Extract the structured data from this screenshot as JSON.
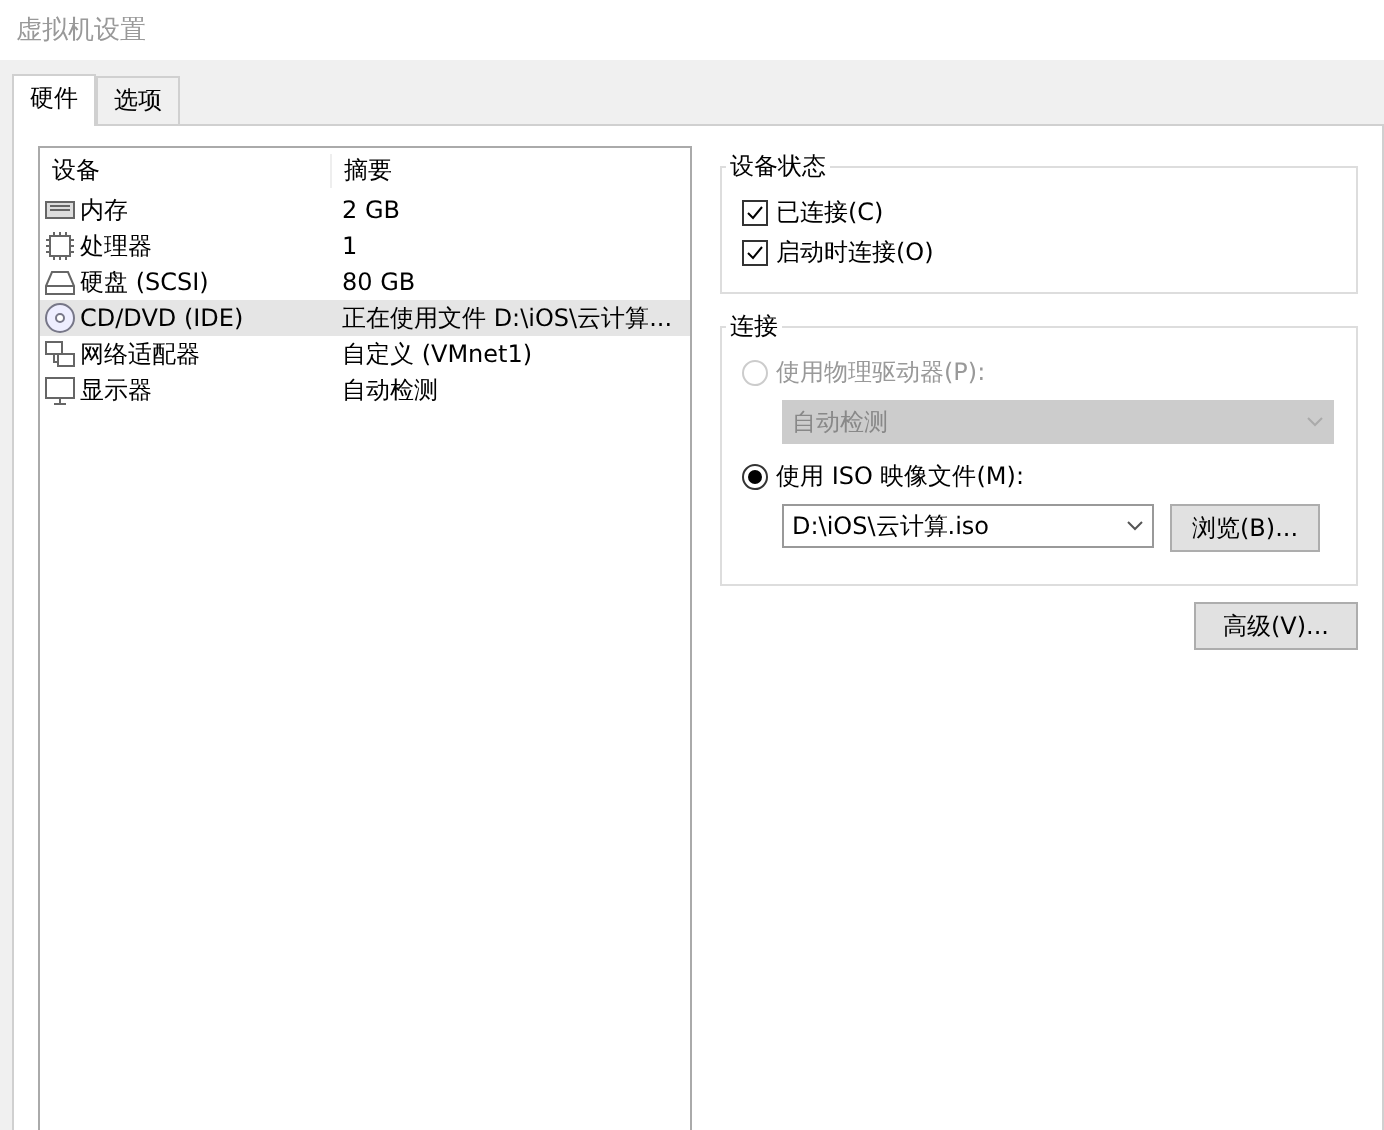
{
  "window": {
    "title": "虚拟机设置"
  },
  "tabs": [
    {
      "label": "硬件",
      "selected": true
    },
    {
      "label": "选项",
      "selected": false
    }
  ],
  "device_table": {
    "columns": [
      "设备",
      "摘要"
    ],
    "rows": [
      {
        "kind": "memory",
        "device": "内存",
        "summary": "2 GB",
        "selected": false
      },
      {
        "kind": "cpu",
        "device": "处理器",
        "summary": "1",
        "selected": false
      },
      {
        "kind": "disk",
        "device": "硬盘 (SCSI)",
        "summary": "80 GB",
        "selected": false
      },
      {
        "kind": "cd",
        "device": "CD/DVD (IDE)",
        "summary": "正在使用文件 D:\\iOS\\云计算...",
        "selected": true
      },
      {
        "kind": "network",
        "device": "网络适配器",
        "summary": "自定义 (VMnet1)",
        "selected": false
      },
      {
        "kind": "display",
        "device": "显示器",
        "summary": "自动检测",
        "selected": false
      }
    ]
  },
  "device_status": {
    "title": "设备状态",
    "options": [
      {
        "label": "已连接(C)",
        "checked": true
      },
      {
        "label": "启动时连接(O)",
        "checked": true
      }
    ]
  },
  "connection": {
    "title": "连接",
    "physical": {
      "label": "使用物理驱动器(P):",
      "selected": false,
      "disabled": true,
      "dropdown": {
        "value": "自动检测",
        "disabled": true
      }
    },
    "iso": {
      "label": "使用 ISO 映像文件(M):",
      "selected": true,
      "disabled": false,
      "dropdown": {
        "value": "D:\\iOS\\云计算.iso",
        "disabled": false
      },
      "browse_button": "浏览(B)..."
    }
  },
  "advanced_button": "高级(V)..."
}
